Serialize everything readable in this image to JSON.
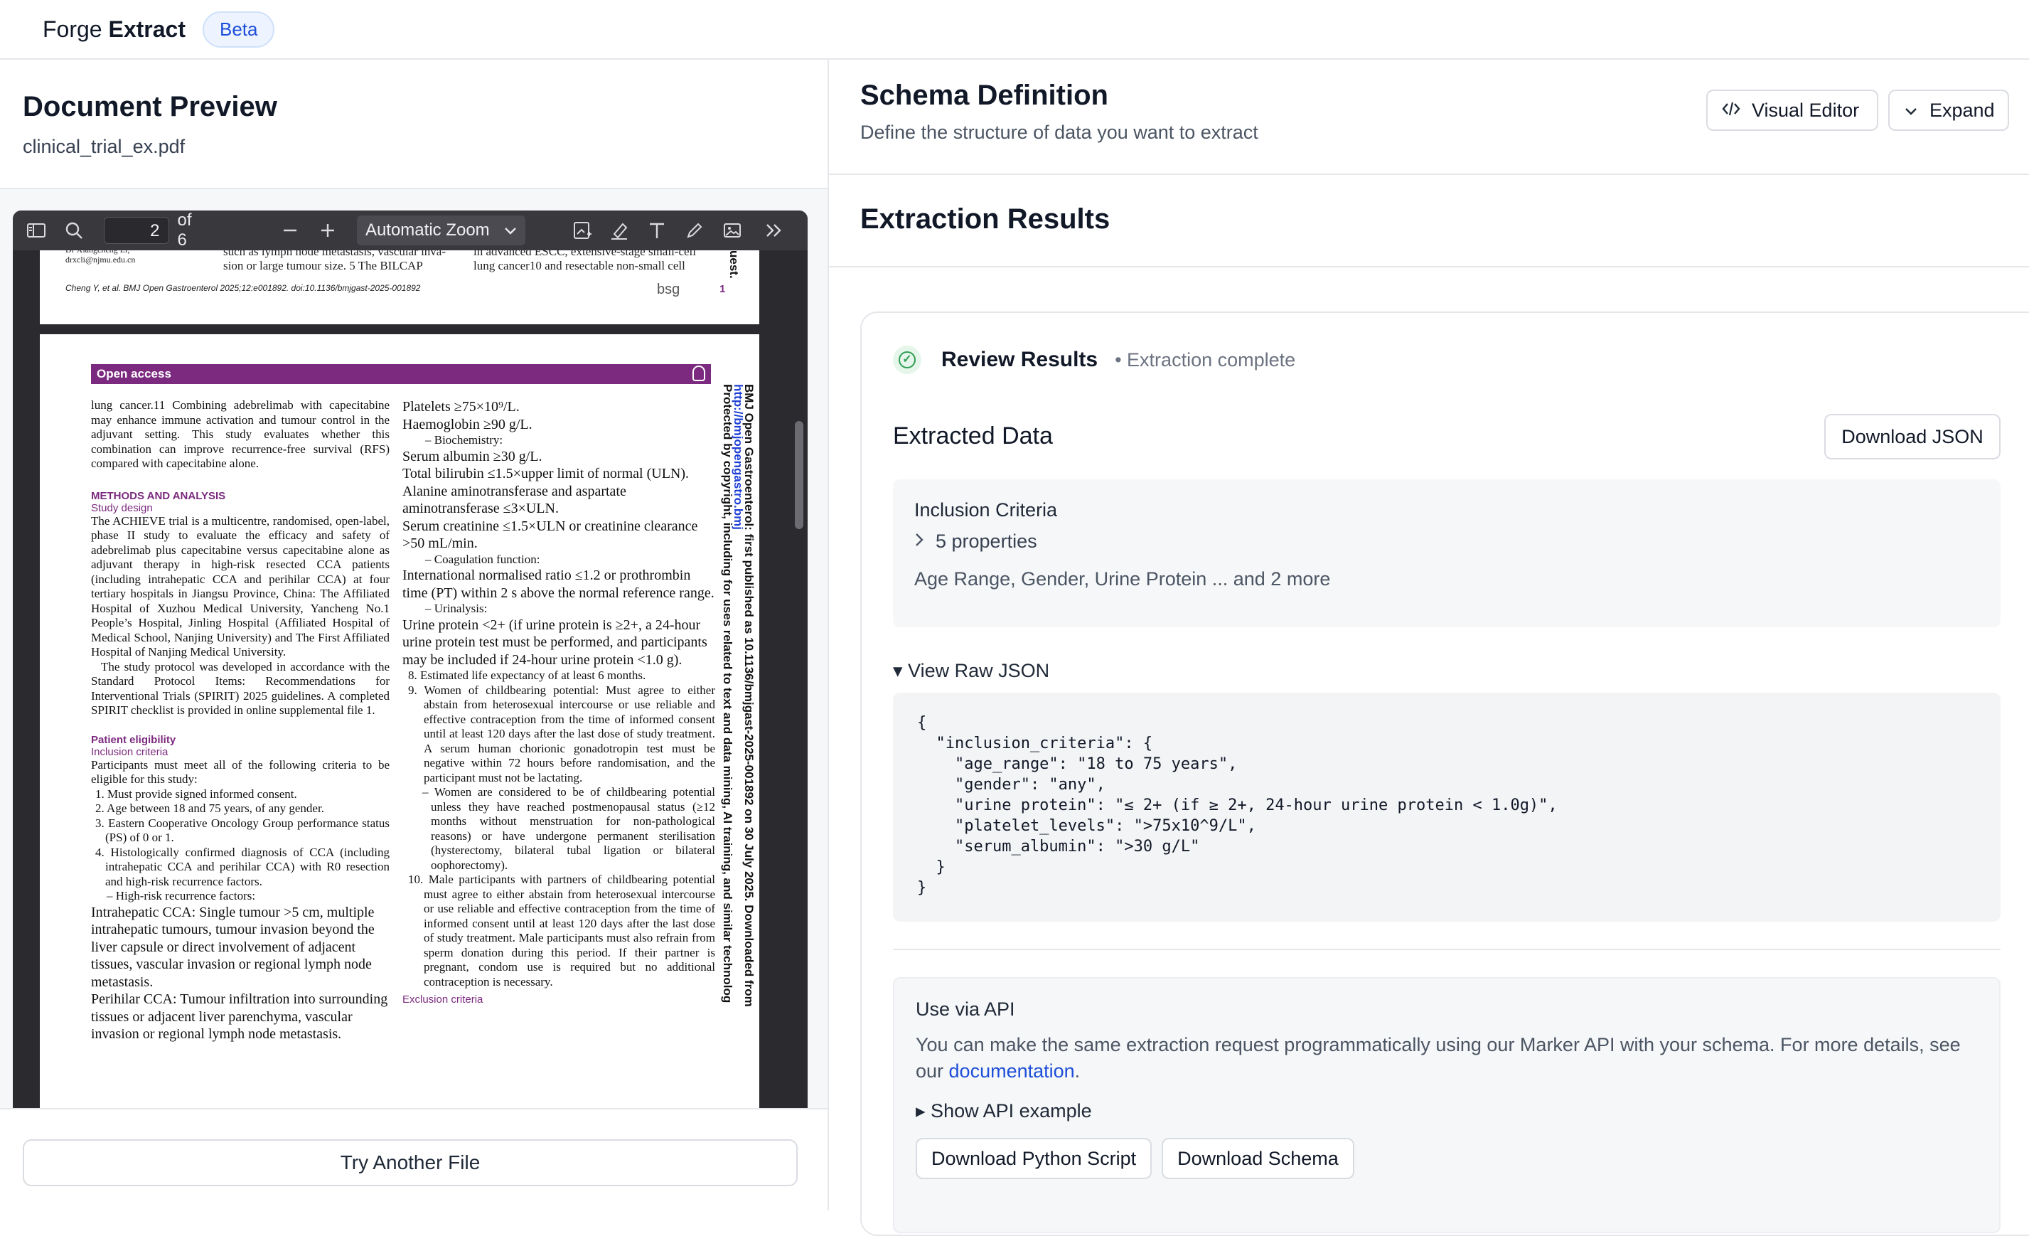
{
  "app": {
    "brand_light": "Forge",
    "brand_bold": "Extract",
    "badge": "Beta"
  },
  "left": {
    "title": "Document Preview",
    "filename": "clinical_trial_ex.pdf",
    "try_another": "Try Another File"
  },
  "viewer": {
    "page_current": "2",
    "page_total": "of 6",
    "zoom": "Automatic Zoom",
    "icons": [
      "sidebar-toggle-icon",
      "search-icon",
      "zoom-out-icon",
      "zoom-in-icon",
      "add-image-icon",
      "highlight-icon",
      "text-icon",
      "draw-icon",
      "image-icon",
      "more-tools-icon"
    ]
  },
  "pdf": {
    "page1_text_left": "Dr Xiangcheng Li;\ndrxcli@njmu.edu.cn",
    "page1_text_mid": "such as lymph node metastasis, vascular inva-\nsion or large tumour size. 5 The BILCAP",
    "page1_text_right": "in advanced ESCC, extensive-stage small-cell\nlung cancer10 and resectable non-small cell",
    "page1_footer": "Cheng Y, et al. BMJ Open Gastroenterol 2025;12:e001892. doi:10.1136/bmjgast-2025-001892",
    "page1_logo": "bsg",
    "page1_number": "1",
    "open_access": "Open access",
    "col1_intro": "lung cancer.11 Combining adebrelimab with capecitabine may enhance immune activation and tumour control in the adjuvant setting. This study evaluates whether this combination can improve recurrence-free survival (RFS) compared with capecitabine alone.",
    "methods_heading": "METHODS AND ANALYSIS",
    "study_design_heading": "Study design",
    "study_design_text": "The ACHIEVE trial is a multicentre, randomised, open-label, phase II study to evaluate the efficacy and safety of adebrelimab plus capecitabine versus capecitabine alone as adjuvant therapy in high-risk resected CCA patients (including intrahepatic CCA and perihilar CCA) at four tertiary hospitals in Jiangsu Province, China: The Affiliated Hospital of Xuzhou Medical University, Yancheng No.1 People’s Hospital, Jinling Hospital (Affiliated Hospital of Medical School, Nanjing University) and The First Affiliated Hospital of Nanjing Medical University.",
    "study_protocol_text": "The study protocol was developed in accordance with the Standard Protocol Items: Recommendations for Interventional Trials (SPIRIT) 2025 guidelines. A completed SPIRIT checklist is provided in online supplemental file 1.",
    "eligibility_heading": "Patient eligibility",
    "inclusion_heading": "Inclusion criteria",
    "inclusion_intro": "Participants must meet all of the following criteria to be eligible for this study:",
    "inclusion_list": [
      "1.  Must provide signed informed consent.",
      "2.  Age between 18 and 75 years, of any gender.",
      "3.  Eastern Cooperative Oncology Group performance status (PS) of 0 or 1.",
      "4.  Histologically confirmed diagnosis of CCA (including intrahepatic CCA and perihilar CCA) with R0 resection and high-risk recurrence factors."
    ],
    "high_risk": "–  High-risk recurrence factors:",
    "intrahepatic": "Intrahepatic CCA: Single tumour >5 cm, multiple intrahepatic tumours, tumour invasion beyond the liver capsule or direct involvement of adjacent tissues, vascular invasion or regional lymph node metastasis.",
    "perihilar": "Perihilar CCA: Tumour infiltration into surrounding tissues or adjacent liver parenchyma, vascular invasion or regional lymph node metastasis.",
    "col2_lab1": "Platelets ≥75×10⁹/L.\nHaemoglobin ≥90 g/L.",
    "biochem": "–  Biochemistry:",
    "col2_lab2": "Serum albumin ≥30 g/L.\nTotal bilirubin ≤1.5×upper limit of normal (ULN).\nAlanine aminotransferase and aspartate aminotransferase ≤3×ULN.\nSerum creatinine ≤1.5×ULN or creatinine clearance >50 mL/min.",
    "coag": "–  Coagulation function:",
    "col2_lab3": "International normalised ratio ≤1.2 or prothrombin time (PT) within 2 s above the normal reference range.",
    "urin": "–  Urinalysis:",
    "col2_lab4": "Urine protein <2+ (if urine protein is ≥2+, a 24-hour urine protein test must be performed, and participants may be included if 24-hour urine protein <1.0 g).",
    "col2_list": [
      "8.  Estimated life expectancy of at least 6 months.",
      "9.  Women of childbearing potential: Must agree to either abstain from heterosexual intercourse or use reliable and effective contraception from the time of informed consent until at least 120 days after the last dose of study treatment. A serum human chorionic gonadotropin test must be negative within 72 hours before randomisation, and the participant must not be lactating.",
      "–  Women are considered to be of childbearing potential unless they have reached postmenopausal status (≥12 months without menstruation for non-pathological reasons) or have undergone permanent sterilisation (hysterectomy, bilateral tubal ligation or bilateral oophorectomy).",
      "10.  Male participants with partners of childbearing potential must agree to either abstain from heterosexual intercourse or use reliable and effective contraception from the time of informed consent until at least 120 days after the last dose of study treatment. Male participants must also refrain from sperm donation during this period. If their partner is pregnant, condom use is required but no additional contraception is necessary."
    ],
    "exclusion_cut": "Exclusion criteria",
    "side_text": "BMJ Open Gastroenterol: first published as 10.1136/bmjgast-2025-001892 on 30 July 2025. Downloaded from ",
    "side_link": "http://bmjopengastro.bmj",
    "side_text2": "Protected by copyright, including for uses related to text and data mining, AI training, and similar technolog",
    "side_top": "uest."
  },
  "schema": {
    "title": "Schema Definition",
    "subtitle": "Define the structure of data you want to extract",
    "visual_editor": "Visual Editor",
    "expand": "Expand"
  },
  "results": {
    "title": "Extraction Results",
    "review_title": "Review Results",
    "status": "• Extraction complete",
    "extracted_title": "Extracted Data",
    "download_json": "Download JSON",
    "inclusion_title": "Inclusion Criteria",
    "properties": "5 properties",
    "summary": "Age Range, Gender, Urine Protein ... and 2 more",
    "raw_toggle": "▾ View Raw JSON",
    "raw_json": "{\n  \"inclusion_criteria\": {\n    \"age_range\": \"18 to 75 years\",\n    \"gender\": \"any\",\n    \"urine protein\": \"≤ 2+ (if ≥ 2+, 24-hour urine protein < 1.0g)\",\n    \"platelet_levels\": \">75x10^9/L\",\n    \"serum_albumin\": \">30 g/L\"\n  }\n}"
  },
  "api": {
    "title": "Use via API",
    "desc": "You can make the same extraction request programmatically using our Marker API with your schema. For more details, see our ",
    "link": "documentation",
    "desc_end": ".",
    "toggle": "▸ Show API example",
    "python": "Download Python Script",
    "schema": "Download Schema"
  },
  "colors": {
    "accent": "#1d4ed8",
    "oa_purple": "#7b2a7f",
    "success": "#2f9e55"
  }
}
